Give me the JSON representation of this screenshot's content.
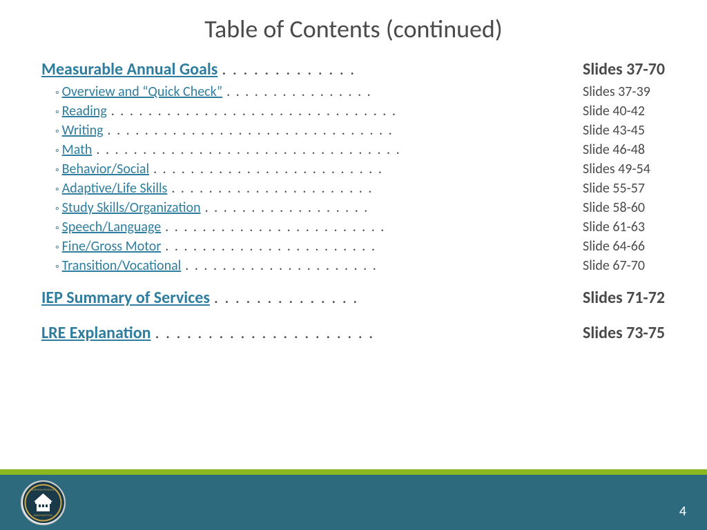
{
  "title": "Table of Contents (continued)",
  "page_number": "4",
  "toc": {
    "main_items": [
      {
        "label": "Measurable Annual Goals",
        "dots": ". . . . . . . . . . . . .",
        "slides": "Slides 37-70",
        "is_main": true
      },
      {
        "label": "IEP Summary of Services",
        "dots": ". . . . . . . . . . . . . .",
        "slides": "Slides 71-72",
        "is_main": true
      },
      {
        "label": "LRE Explanation",
        "dots": ". . . . . . . . . . . . . . . . . . . . .",
        "slides": "Slides 73-75",
        "is_main": true
      }
    ],
    "sub_items": [
      {
        "label": "Overview and “Quick Check”",
        "dots": ". . . . . . . . . . . . . . . .",
        "slides": "Slides 37-39"
      },
      {
        "label": "Reading",
        "dots": ". . . . . . . . . . . . . . . . . . . . . . . . . . . . . . .",
        "slides": "Slide 40-42"
      },
      {
        "label": "Writing",
        "dots": ". . . . . . . . . . . . . . . . . . . . . . . . . . . . . . .",
        "slides": "Slide 43-45"
      },
      {
        "label": "Math",
        "dots": ". . . . . . . . . . . . . . . . . . . . . . . . . . . . . . . . .",
        "slides": "Slide 46-48"
      },
      {
        "label": "Behavior/Social",
        "dots": ". . . . . . . . . . . . . . . . . . . . . . . . .",
        "slides": "Slides 49-54"
      },
      {
        "label": "Adaptive/Life Skills",
        "dots": ". . . . . . . . . . . . . . . . . . . . . .",
        "slides": "Slide 55-57"
      },
      {
        "label": "Study Skills/Organization",
        "dots": ". . . . . . . . . . . . . . . . . .",
        "slides": "Slide 58-60"
      },
      {
        "label": "Speech/Language",
        "dots": ". . . . . . . . . . . . . . . . . . . . . . . .",
        "slides": "Slide 61-63"
      },
      {
        "label": "Fine/Gross Motor",
        "dots": ". . . . . . . . . . . . . . . . . . . . . . .",
        "slides": "Slide 64-66"
      },
      {
        "label": "Transition/Vocational",
        "dots": ". . . . . . . . . . . . . . . . . . . . .",
        "slides": "Slide 67-70"
      }
    ]
  },
  "logo": {
    "top_text": "SUPERINTENDENT OF PUBLIC",
    "bottom_text": "WASHINGTON",
    "middle_text": "INSTRUCTION"
  },
  "colors": {
    "link": "#2e7d9e",
    "text": "#4a4a4a",
    "green_bar": "#8ab820",
    "blue_bar": "#2e6a7e"
  }
}
